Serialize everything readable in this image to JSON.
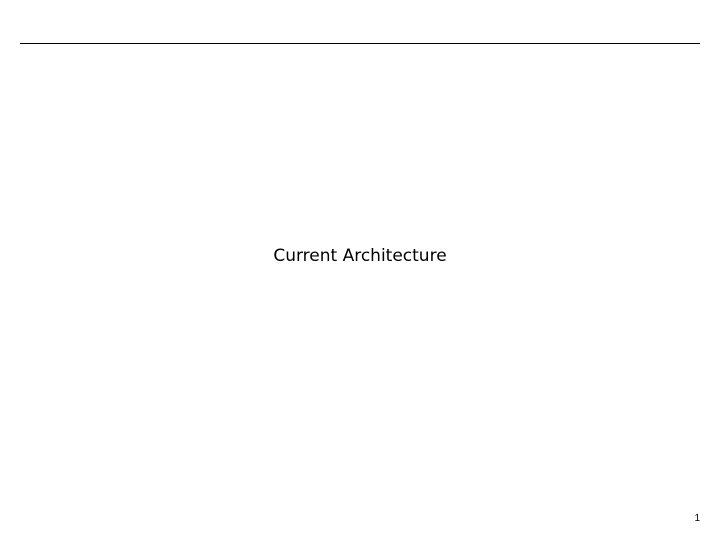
{
  "slide": {
    "title": "Current Architecture",
    "page_number": "1"
  },
  "colors": {
    "background": "#ffffff",
    "text": "#000000",
    "rule": "#000000"
  }
}
